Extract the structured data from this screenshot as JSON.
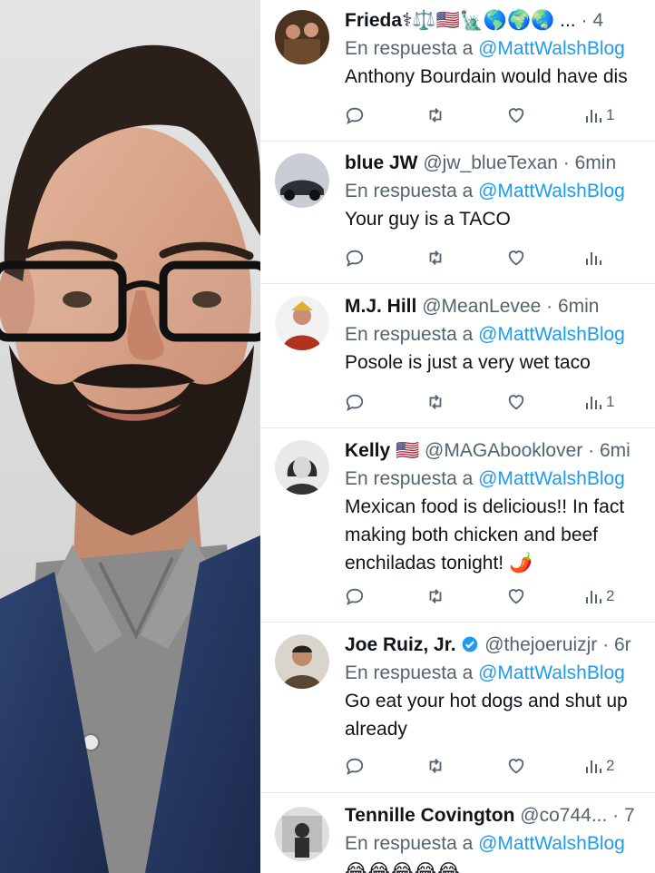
{
  "photo": {
    "description_icon": "portrait-photo"
  },
  "tweets": [
    {
      "name": "Frieda",
      "name_suffix": "⚕⚖️🇺🇸🗽🌎🌍🌏 ...",
      "handle": "",
      "dot": "·",
      "time": "4",
      "reply_prefix": "En respuesta a",
      "reply_to": "@MattWalshBlog",
      "text": "Anthony Bourdain would have dis",
      "views": "1",
      "avatar_color": "#6b4a2e"
    },
    {
      "name": "blue JW",
      "name_suffix": "",
      "handle": "@jw_blueTexan",
      "dot": "·",
      "time": "6min",
      "reply_prefix": "En respuesta a",
      "reply_to": "@MattWalshBlog",
      "text": "Your guy is a TACO",
      "views": "",
      "avatar_color": "#9aa4ad"
    },
    {
      "name": "M.J. Hill",
      "name_suffix": "",
      "handle": "@MeanLevee",
      "dot": "·",
      "time": "6min",
      "reply_prefix": "En respuesta a",
      "reply_to": "@MattWalshBlog",
      "text": "Posole is just a very wet taco",
      "views": "1",
      "avatar_color": "#b3321f"
    },
    {
      "name": "Kelly",
      "name_suffix": "🇺🇸",
      "handle": "@MAGAbooklover",
      "dot": "·",
      "time": "6mi",
      "reply_prefix": "En respuesta a",
      "reply_to": "@MattWalshBlog",
      "text": "Mexican food is delicious!! In fact making both chicken and beef enchiladas tonight! 🌶️",
      "views": "2",
      "avatar_color": "#3a3a3a"
    },
    {
      "name": "Joe Ruiz, Jr.",
      "name_suffix": "",
      "handle": "@thejoeruizjr",
      "dot": "·",
      "time": "6r",
      "reply_prefix": "En respuesta a",
      "reply_to": "@MattWalshBlog",
      "text": "Go eat your hot dogs and shut up already",
      "views": "2",
      "avatar_color": "#5b4636"
    },
    {
      "name": "Tennille Covington",
      "name_suffix": "",
      "handle": "@co744...",
      "dot": "·",
      "time": "7",
      "reply_prefix": "En respuesta a",
      "reply_to": "@MattWalshBlog",
      "text": "😂😂😂😂😂",
      "views": "",
      "avatar_color": "#cfcfcf"
    }
  ],
  "colors": {
    "link": "#1d9bf0",
    "muted": "#536471",
    "text": "#0f1419",
    "verified": "#1d9bf0"
  }
}
